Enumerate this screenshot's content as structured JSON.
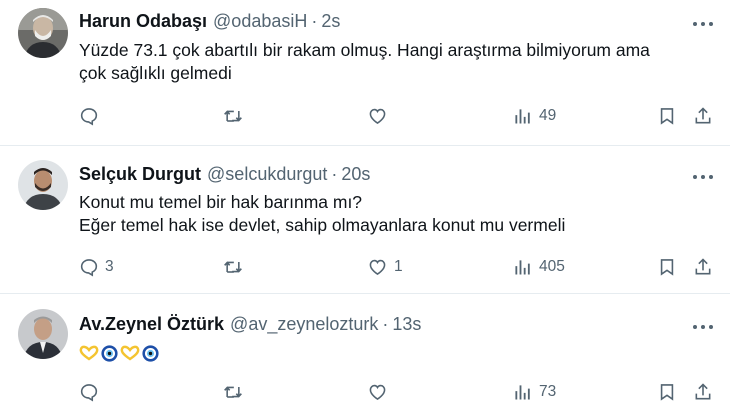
{
  "tweets": [
    {
      "name": "Harun Odabaşı",
      "handle": "@odabasiH",
      "separator": "·",
      "time": "2s",
      "lines": [
        "Yüzde 73.1 çok abartılı bir rakam olmuş. Hangi araştırma bilmiyorum ama",
        "çok sağlıklı gelmedi"
      ],
      "replies": "",
      "retweets": "",
      "likes": "",
      "views": "49"
    },
    {
      "name": "Selçuk Durgut",
      "handle": "@selcukdurgut",
      "separator": "·",
      "time": "20s",
      "lines": [
        "Konut mu temel bir hak barınma mı?",
        "Eğer temel hak ise devlet, sahip olmayanlara konut mu vermeli"
      ],
      "replies": "3",
      "retweets": "",
      "likes": "1",
      "views": "405"
    },
    {
      "name": "Av.Zeynel Öztürk",
      "handle": "@av_zeynelozturk",
      "separator": "·",
      "time": "13s",
      "emojis": [
        "heart-hands",
        "nazar-amulet",
        "heart-hands",
        "nazar-amulet"
      ],
      "replies": "",
      "retweets": "",
      "likes": "",
      "views": "73"
    }
  ],
  "icons": {
    "reply": "reply-icon",
    "retweet": "retweet-icon",
    "like": "heart-icon",
    "views": "views-icon",
    "bookmark": "bookmark-icon",
    "share": "share-icon",
    "more": "more-icon"
  },
  "colors": {
    "text": "#0f1419",
    "secondary": "#536471",
    "divider": "#e6ecf0"
  }
}
